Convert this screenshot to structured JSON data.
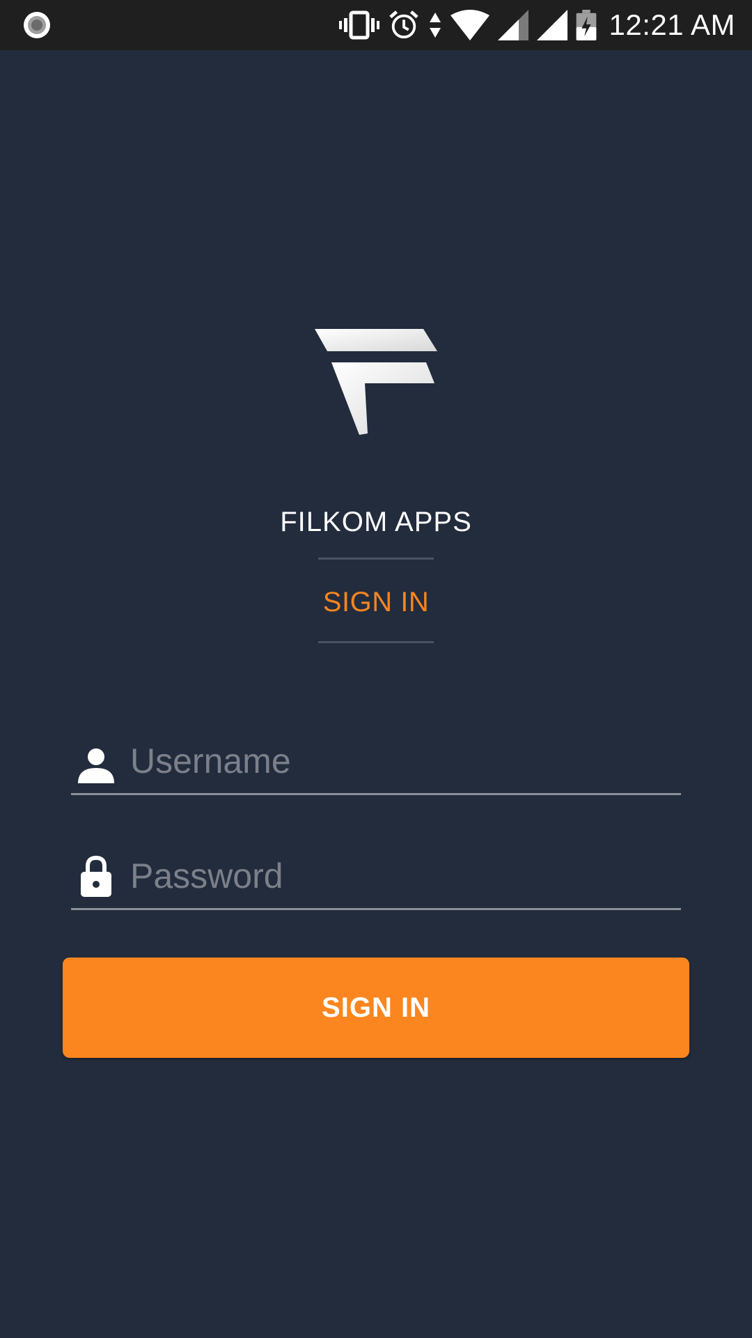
{
  "status_bar": {
    "time": "12:21 AM",
    "icons": [
      "record-icon",
      "vibrate-icon",
      "alarm-icon",
      "data-arrows-icon",
      "wifi-icon",
      "signal-icon",
      "signal-icon",
      "battery-charging-icon"
    ]
  },
  "app": {
    "name": "FILKOM APPS",
    "tab_label": "SIGN IN"
  },
  "form": {
    "username": {
      "placeholder": "Username",
      "value": "",
      "icon": "person-icon"
    },
    "password": {
      "placeholder": "Password",
      "value": "",
      "icon": "lock-icon"
    },
    "submit_label": "SIGN IN"
  },
  "colors": {
    "background": "#232c3d",
    "accent": "#fb861f",
    "status_bar": "#1f1f1f"
  }
}
